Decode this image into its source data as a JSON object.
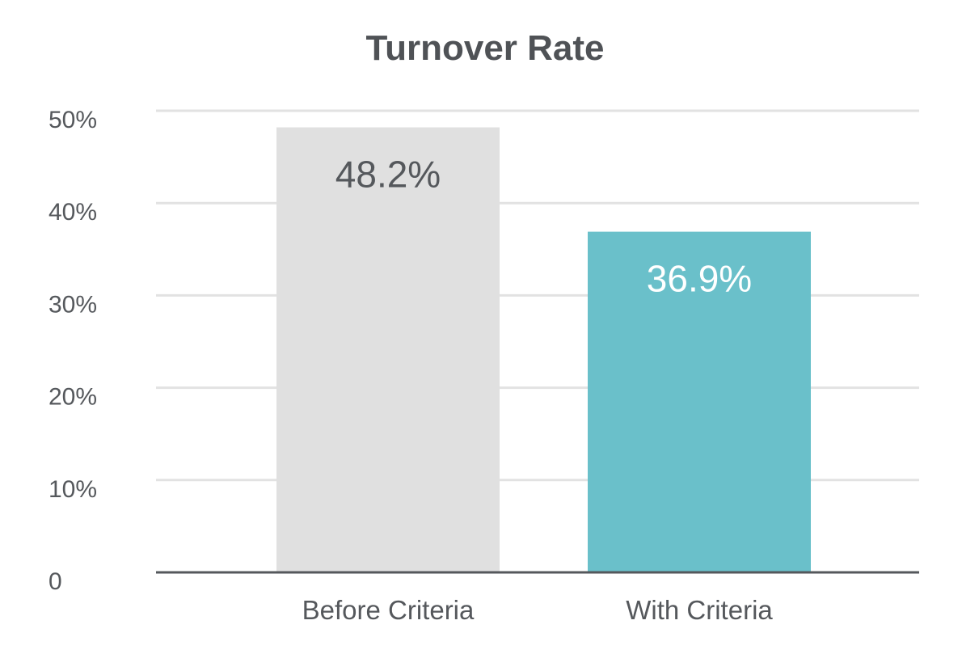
{
  "chart_data": {
    "type": "bar",
    "title": "Turnover Rate",
    "xlabel": "",
    "ylabel": "",
    "categories": [
      "Before Criteria",
      "With Criteria"
    ],
    "values": [
      48.2,
      36.9
    ],
    "data_labels": [
      "48.2%",
      "36.9%"
    ],
    "bar_colors": [
      "#e0e0e0",
      "#6ac0ca"
    ],
    "data_label_colors": [
      "#55585c",
      "#ffffff"
    ],
    "ylim": [
      0,
      50
    ],
    "yticks": [
      0,
      10,
      20,
      30,
      40,
      50
    ],
    "ytick_labels": [
      "0",
      "10%",
      "20%",
      "30%",
      "40%",
      "50%"
    ],
    "grid": true,
    "legend": "none"
  }
}
